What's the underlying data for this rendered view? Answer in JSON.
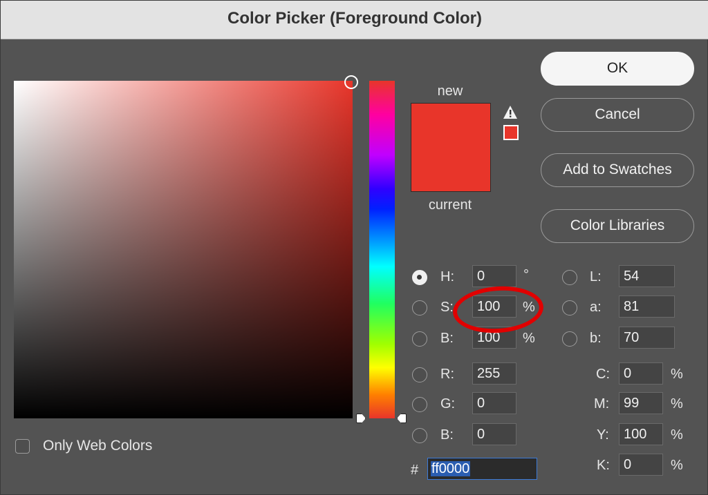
{
  "window": {
    "title": "Color Picker (Foreground Color)"
  },
  "preview": {
    "new_label": "new",
    "current_label": "current",
    "color": "#e8352a"
  },
  "buttons": {
    "ok": "OK",
    "cancel": "Cancel",
    "add_swatches": "Add to Swatches",
    "libraries": "Color Libraries"
  },
  "hsb": {
    "h": {
      "label": "H:",
      "value": "0",
      "unit": "°",
      "selected": true
    },
    "s": {
      "label": "S:",
      "value": "100",
      "unit": "%"
    },
    "b": {
      "label": "B:",
      "value": "100",
      "unit": "%"
    }
  },
  "rgb": {
    "r": {
      "label": "R:",
      "value": "255"
    },
    "g": {
      "label": "G:",
      "value": "0"
    },
    "b": {
      "label": "B:",
      "value": "0"
    }
  },
  "lab": {
    "l": {
      "label": "L:",
      "value": "54"
    },
    "a": {
      "label": "a:",
      "value": "81"
    },
    "b": {
      "label": "b:",
      "value": "70"
    }
  },
  "cmyk": {
    "c": {
      "label": "C:",
      "value": "0",
      "unit": "%"
    },
    "m": {
      "label": "M:",
      "value": "99",
      "unit": "%"
    },
    "y": {
      "label": "Y:",
      "value": "100",
      "unit": "%"
    },
    "k": {
      "label": "K:",
      "value": "0",
      "unit": "%"
    }
  },
  "hex": {
    "prefix": "#",
    "value": "ff0000"
  },
  "options": {
    "only_web_colors": "Only Web Colors"
  },
  "colors": {
    "annotation": "#e10000",
    "accent": "#3c7bd8"
  }
}
